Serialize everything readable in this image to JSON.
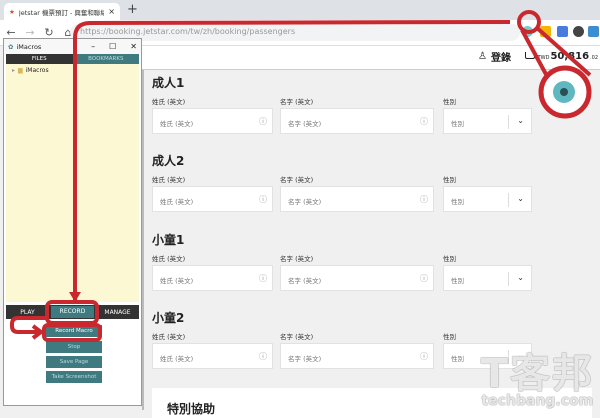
{
  "browser": {
    "tab_title": "Jetstar 機票預訂 - 興奮和聯絡方式",
    "url": "https://booking.jetstar.com/tw/zh/booking/passengers"
  },
  "header": {
    "login": "登錄",
    "cart_currency": "TWD",
    "cart_amount": "50,816",
    "cart_cents": ".02"
  },
  "sections": [
    {
      "title": "成人1",
      "last_label": "姓氏 (英文)",
      "last_placeholder": "姓氏 (英文)",
      "first_label": "名字 (英文)",
      "first_placeholder": "名字 (英文)",
      "gender_label": "性別",
      "gender_placeholder": "性別"
    },
    {
      "title": "成人2",
      "last_label": "姓氏 (英文)",
      "last_placeholder": "姓氏 (英文)",
      "first_label": "名字 (英文)",
      "first_placeholder": "名字 (英文)",
      "gender_label": "性別",
      "gender_placeholder": "性別"
    },
    {
      "title": "小童1",
      "last_label": "姓氏 (英文)",
      "last_placeholder": "姓氏 (英文)",
      "first_label": "名字 (英文)",
      "first_placeholder": "名字 (英文)",
      "gender_label": "性別",
      "gender_placeholder": "性別"
    },
    {
      "title": "小童2",
      "last_label": "姓氏 (英文)",
      "last_placeholder": "姓氏 (英文)",
      "first_label": "名字 (英文)",
      "first_placeholder": "名字 (英文)",
      "gender_label": "性別",
      "gender_placeholder": "性別"
    }
  ],
  "special_assistance": "特別協助",
  "imacros": {
    "title": "iMacros",
    "tabs": [
      "FILES",
      "BOOKMARKS"
    ],
    "tree_root": "iMacros",
    "bottom_tabs": [
      "PLAY",
      "RECORD",
      "MANAGE"
    ],
    "buttons": [
      "Record Macro",
      "Stop",
      "Save Page",
      "Take Screenshot"
    ]
  },
  "watermark": {
    "cn": "T客邦",
    "en": "techbang.com"
  },
  "colors": {
    "annotation": "#c8282e",
    "imacros_teal": "#3e7a80"
  }
}
